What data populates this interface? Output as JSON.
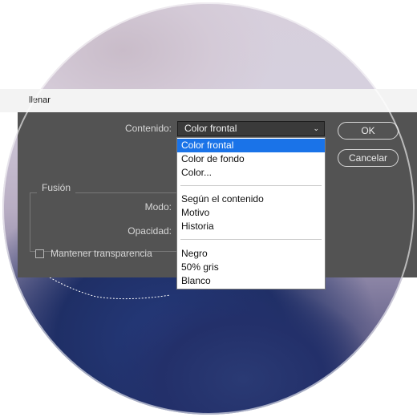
{
  "dialog": {
    "title": "llenar",
    "contenido_label": "Contenido:",
    "contenido_value": "Color frontal",
    "ok_label": "OK",
    "cancel_label": "Cancelar",
    "fusion_legend": "Fusión",
    "modo_label": "Modo:",
    "opacidad_label": "Opacidad:",
    "mantener_label": "Mantener transparencia",
    "mantener_checked": false
  },
  "dropdown": {
    "options": [
      "Color frontal",
      "Color de fondo",
      "Color...",
      "Según el contenido",
      "Motivo",
      "Historia",
      "Negro",
      "50% gris",
      "Blanco"
    ],
    "selected": "Color frontal"
  },
  "colors": {
    "dialog_bg": "#535353",
    "highlight": "#1a73e8",
    "titlebar_bg": "#f3f3f3"
  }
}
